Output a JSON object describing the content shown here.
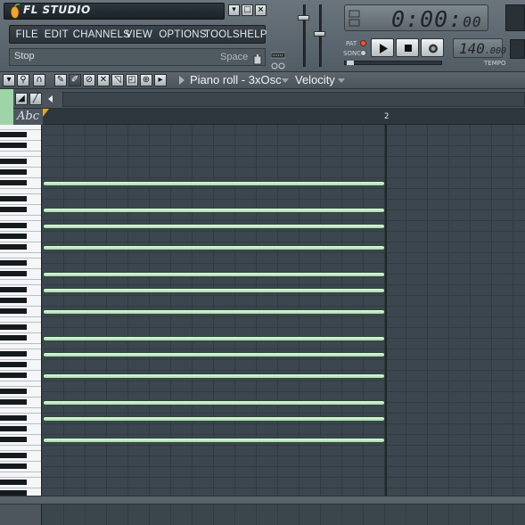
{
  "app": {
    "title": "FL STUDIO",
    "window_buttons": [
      "▾",
      "□",
      "×"
    ]
  },
  "menu": [
    "FILE",
    "EDIT",
    "CHANNELS",
    "VIEW",
    "OPTIONS",
    "TOOLS",
    "HELP"
  ],
  "hint_bar": {
    "text": "Stop",
    "shortcut": "Space"
  },
  "transport": {
    "time_main": "0:00:",
    "time_ms": "00",
    "mode_labels": {
      "pat": "PAT",
      "song": "SONG"
    },
    "tempo_int": "140",
    "tempo_dec": ".000",
    "tempo_label": "TEMPO",
    "colors": {
      "pat_led": "#e25a3c",
      "song_led": "#c9cfd3"
    }
  },
  "piano_roll": {
    "title": "Piano roll - 3xOsc",
    "target": "Velocity",
    "tools": [
      "menu-icon",
      "magnet-icon",
      "snap-icon",
      "pencil-icon",
      "paint-icon",
      "delete-icon",
      "mute-icon",
      "slice-icon",
      "select-icon",
      "zoom-icon",
      "playback-icon"
    ],
    "row2_tools": [
      "up-arrow-icon",
      "line-icon",
      "left-arrow-icon"
    ],
    "ruler_label": "Abc",
    "bar_marker": "2",
    "note_color": "#bfe8c6",
    "notes": [
      {
        "row": 1
      },
      {
        "row": 2
      },
      {
        "row": 3
      },
      {
        "row": 4
      },
      {
        "row": 5
      },
      {
        "row": 6
      },
      {
        "row": 7
      },
      {
        "row": 8
      },
      {
        "row": 9
      },
      {
        "row": 10
      },
      {
        "row": 11
      },
      {
        "row": 12
      },
      {
        "row": 13
      }
    ]
  }
}
